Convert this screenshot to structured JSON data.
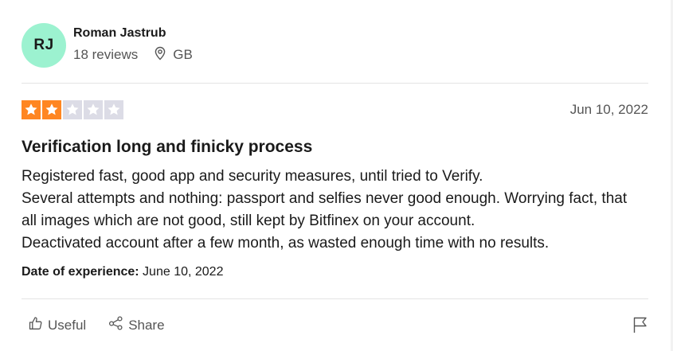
{
  "reviewer": {
    "initials": "RJ",
    "name": "Roman Jastrub",
    "reviews": "18 reviews",
    "country": "GB",
    "avatar_color": "#9cf2d0"
  },
  "rating": {
    "stars": 2,
    "max": 5,
    "filled_color": "#ff8622",
    "empty_color": "#dcdce6"
  },
  "review": {
    "date": "Jun 10, 2022",
    "title": "Verification long and finicky process",
    "body": [
      "Registered fast, good app and security measures, until tried to Verify.",
      "Several attempts and nothing: passport and selfies never good enough. Worrying fact, that all images which are not good, still kept by Bitfinex on your account.",
      "Deactivated account after a few month, as wasted enough time with no results."
    ],
    "experience_label": "Date of experience:",
    "experience_date": " June 10, 2022"
  },
  "actions": {
    "useful_label": "Useful",
    "useful_icon": "thumbs-up-icon",
    "share_label": "Share",
    "share_icon": "share-icon",
    "flag_icon": "flag-icon"
  }
}
